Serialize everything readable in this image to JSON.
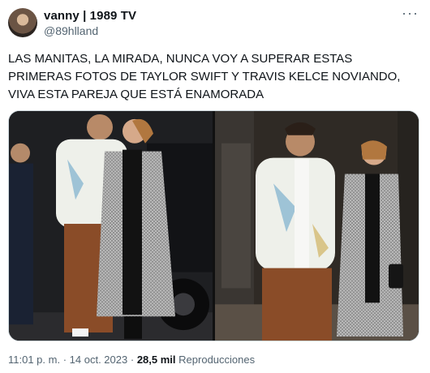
{
  "header": {
    "display_name": "vanny | 1989 TV",
    "handle": "@89hlland",
    "more_label": "···"
  },
  "tweet": {
    "text": "LAS MANITAS, LA MIRADA, NUNCA VOY A SUPERAR ESTAS PRIMERAS FOTOS DE TAYLOR SWIFT Y TRAVIS KELCE NOVIANDO, VIVA ESTA PAREJA QUE ESTÁ ENAMORADA"
  },
  "metadata": {
    "time": "11:01 p. m.",
    "separator": "·",
    "date": "14 oct. 2023",
    "views_count": "28,5 mil",
    "views_label": "Reproducciones"
  }
}
